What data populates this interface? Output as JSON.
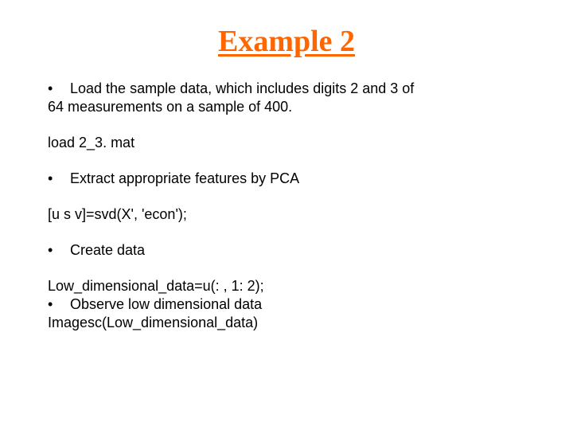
{
  "title": "Example 2",
  "items": {
    "bullet_glyph": "•",
    "b1_text": "Load the sample data, which includes  digits 2 and 3 of",
    "b1_cont": "64 measurements on a sample of 400.",
    "code1": "load 2_3. mat",
    "b2_text": "Extract appropriate features by PCA",
    "code2": "[u s v]=svd(X', 'econ');",
    "b3_text": "Create data",
    "code3": "Low_dimensional_data=u(: , 1: 2);",
    "b4_text": "Observe low dimensional data",
    "code4": "Imagesc(Low_dimensional_data)"
  }
}
